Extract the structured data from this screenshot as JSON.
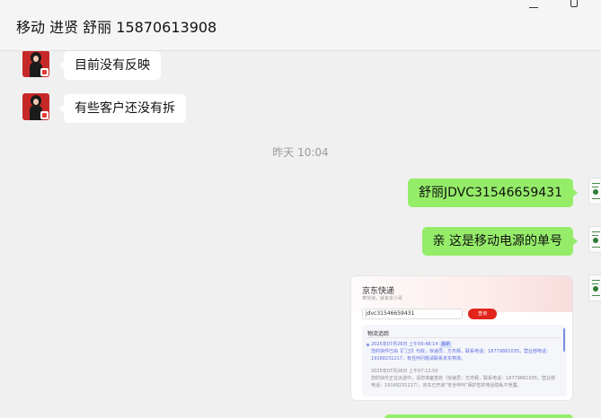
{
  "header": {
    "title": "移动 进贤 舒丽 15870613908"
  },
  "messages": [
    {
      "side": "left",
      "text": "目前没有反映"
    },
    {
      "side": "left",
      "text": "有些客户还没有拆"
    },
    {
      "side": "right",
      "text": "舒丽JDVC31546659431"
    },
    {
      "side": "right",
      "text": "亲 这是移动电源的单号"
    }
  ],
  "timestamp": "昨天 10:04",
  "jd_card": {
    "title": "京东快递",
    "subtitle": "寄快递，就来京小哥",
    "input_value": "jdvc31546659431",
    "search_label": "查询",
    "section_label": "物流追踪",
    "events": [
      {
        "time": "2025年07月26日 上午09:48:14",
        "tag": "最新",
        "text": "您的快件已由【门卫】代收，快递员：万杰辉，联系电话：18779861035，营业部电话：19168231217，有任何问题请联系京东物流。"
      },
      {
        "time": "2025年07月26日 上午07:12:50",
        "tag": "",
        "text": "您的快件正在派送中，请您准备签收（快递员：万杰辉，联系电话：18779861035，营业部电话：19168231217），京东已开启“安全呼叫”保护您的电话隐私不泄露。"
      }
    ]
  },
  "colors": {
    "sent_bubble": "#95ec69",
    "received_bubble": "#ffffff",
    "background": "#f0f0f0",
    "jd_red": "#e1251b"
  }
}
